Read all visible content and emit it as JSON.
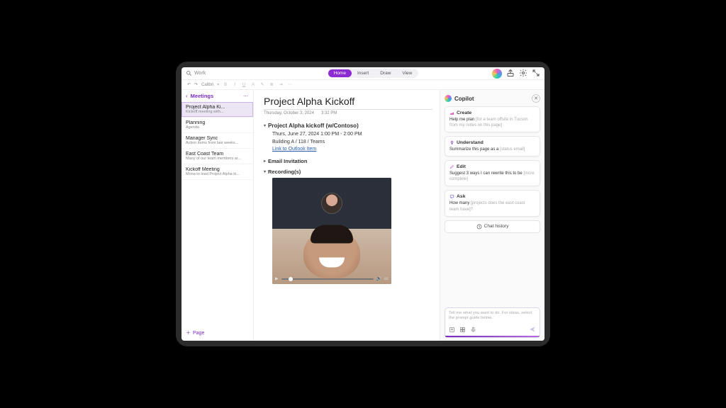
{
  "search": {
    "placeholder": "Work"
  },
  "tabs": {
    "home": "Home",
    "insert": "Insert",
    "draw": "Draw",
    "view": "View"
  },
  "format": {
    "font": "Calibri"
  },
  "sidebar": {
    "section": "Meetings",
    "add_page": "Page",
    "items": [
      {
        "title": "Project Alpha Ki...",
        "sub": "Kickoff meeting with..."
      },
      {
        "title": "Planning",
        "sub": "Agenda"
      },
      {
        "title": "Manager Sync",
        "sub": "Action items from last weeks..."
      },
      {
        "title": "East Coast Team",
        "sub": "Many of our team members ar..."
      },
      {
        "title": "Kickoff Meeting",
        "sub": "Mona to lead Project Alpha ki..."
      }
    ]
  },
  "page": {
    "title": "Project Alpha Kickoff",
    "date": "Thursday, October 3, 2024",
    "time": "3:32 PM",
    "heading": "Project Alpha kickoff (w/Contoso)",
    "when": "Thurs, June 27, 2024 1:00 PM - 2:00 PM",
    "where": "Building A / 118 / Teams",
    "outlook_link": "Link to Outlook Item",
    "email_invite": "Email Invitation",
    "recordings": "Recording(s)"
  },
  "copilot": {
    "title": "Copilot",
    "cards": [
      {
        "icon": "#d85bb9",
        "head": "Create",
        "text": "Help me plan ",
        "hint": "[for a team offsite in Tucson from my notes on this page]"
      },
      {
        "icon": "#7a2bbd",
        "head": "Understand",
        "text": "Summarize this page as a ",
        "hint": "[status email]"
      },
      {
        "icon": "#c773d9",
        "head": "Edit",
        "text": "Suggest 3 ways I can rewrite this to be ",
        "hint": "[more complete]"
      },
      {
        "icon": "#6a5bd8",
        "head": "Ask",
        "text": "How many ",
        "hint": "[projects does the east coast team have]?"
      }
    ],
    "history": "Chat history",
    "placeholder": "Tell me what you want to do. For ideas, select the prompt guide below."
  }
}
